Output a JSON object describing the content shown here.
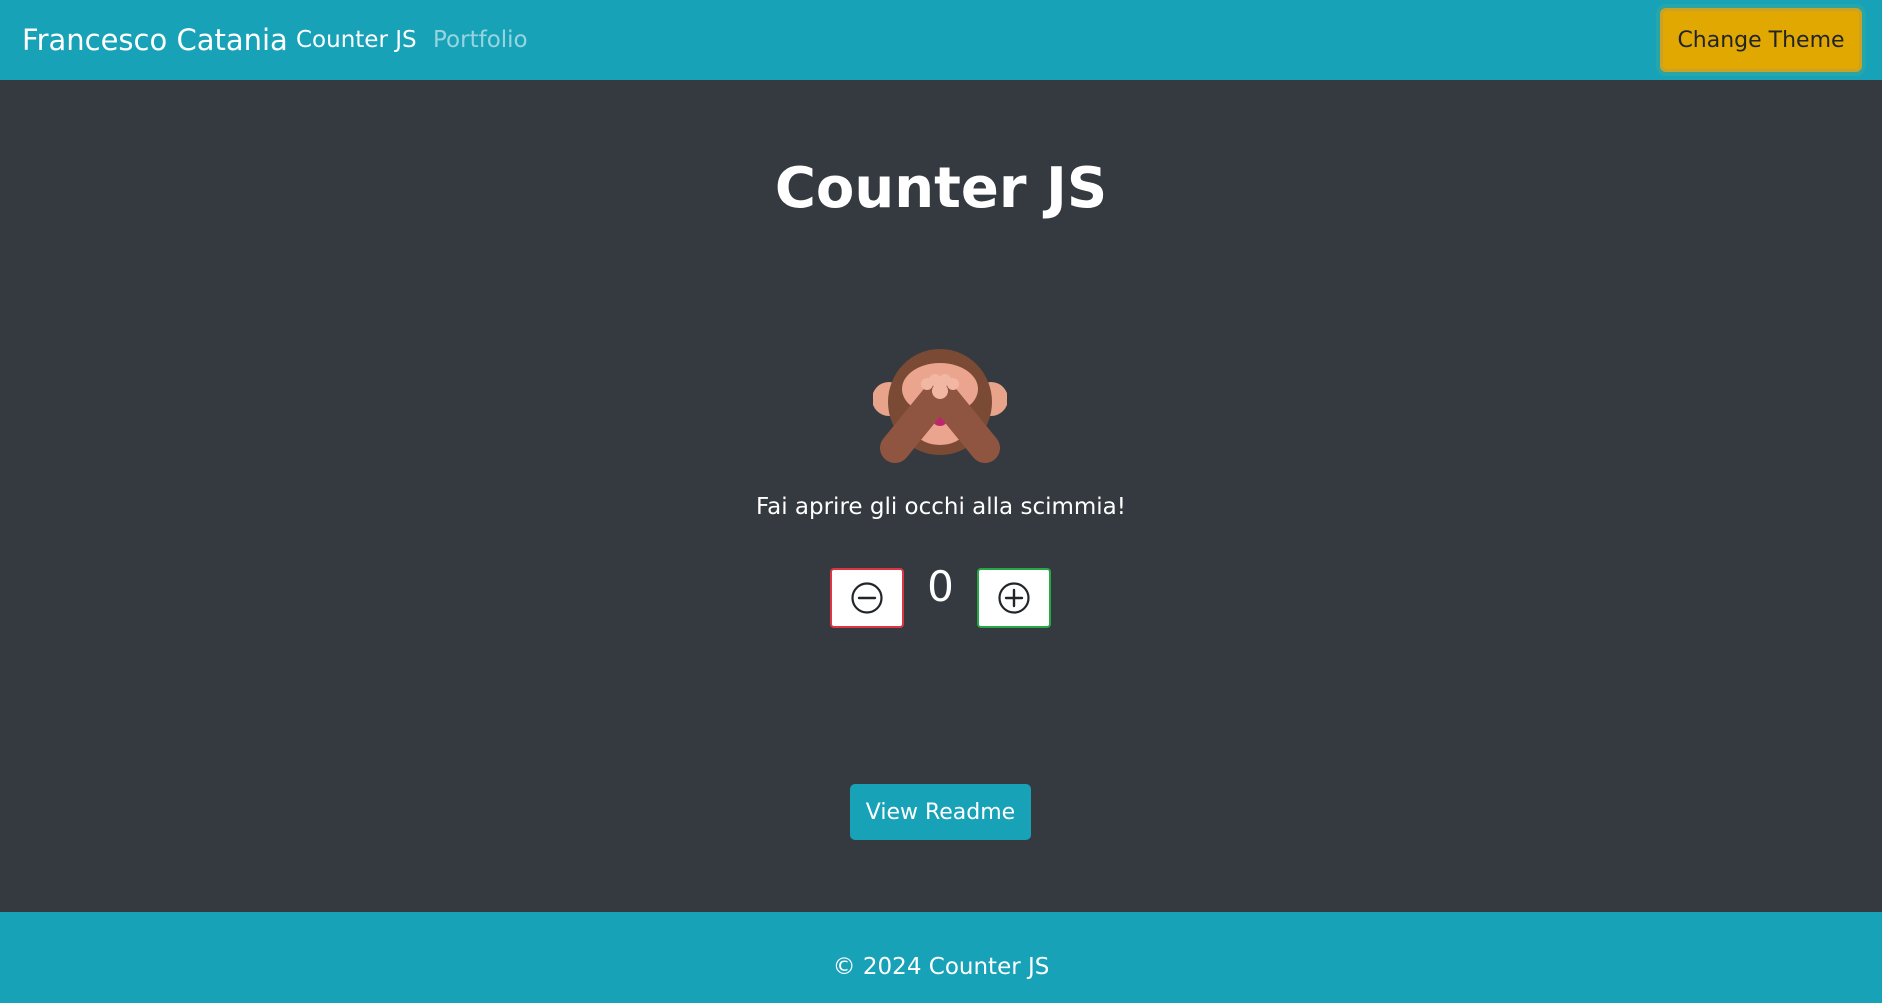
{
  "navbar": {
    "brand": "Francesco Catania",
    "links": [
      {
        "label": "Counter JS",
        "active": true
      },
      {
        "label": "Portfolio",
        "active": false
      }
    ],
    "theme_button": "Change Theme"
  },
  "main": {
    "title": "Counter JS",
    "monkey_icon": "see-no-evil-monkey",
    "message": "Fai aprire gli occhi alla scimmia!",
    "counter": {
      "value": "0",
      "decrement_icon": "circle-minus-icon",
      "increment_icon": "circle-plus-icon"
    },
    "readme_button": "View Readme"
  },
  "footer": {
    "text": "© 2024 Counter JS"
  },
  "colors": {
    "primary": "#17a2b8",
    "background": "#343a40",
    "theme_button": "#e0a800",
    "danger_border": "#dc3545",
    "success_border": "#28a745"
  }
}
